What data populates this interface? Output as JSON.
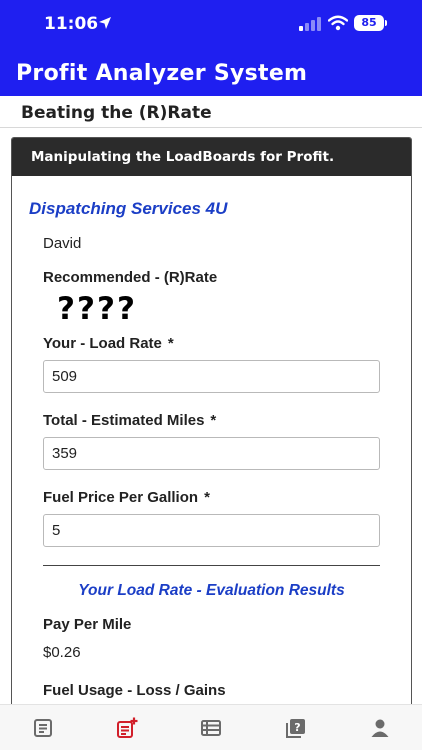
{
  "status_bar": {
    "time": "11:06",
    "battery": "85"
  },
  "header": {
    "title": "Profit Analyzer System"
  },
  "page": {
    "subtitle": "Beating the (R)Rate"
  },
  "card": {
    "title": "Manipulating the LoadBoards for Profit.",
    "company": "Dispatching Services 4U",
    "user_name": "David",
    "recommended_label": "Recommended - (R)Rate",
    "recommended_value": "????"
  },
  "form": {
    "load_rate": {
      "label": "Your - Load Rate",
      "required_mark": "*",
      "value": "509"
    },
    "miles": {
      "label": "Total - Estimated Miles",
      "required_mark": "*",
      "value": "359"
    },
    "fuel_price": {
      "label": "Fuel Price Per Gallion",
      "required_mark": "*",
      "value": "5"
    }
  },
  "results": {
    "title": "Your Load Rate - Evaluation Results",
    "pay_per_mile_label": "Pay Per Mile",
    "pay_per_mile_value": "$0.26",
    "fuel_usage_label": "Fuel Usage - Loss / Gains"
  },
  "tab_bar": {
    "tabs": [
      {
        "icon": "document-list-icon",
        "active": false
      },
      {
        "icon": "add-document-icon",
        "active": true
      },
      {
        "icon": "table-list-icon",
        "active": false
      },
      {
        "icon": "help-icon",
        "active": false
      },
      {
        "icon": "profile-icon",
        "active": false
      }
    ],
    "active_color": "#d11f2a",
    "inactive_color": "#6b6b6b"
  },
  "colors": {
    "brand_blue": "#1f1ff0",
    "accent_blue": "#1b3ec6",
    "card_header": "#2b2b2b"
  }
}
